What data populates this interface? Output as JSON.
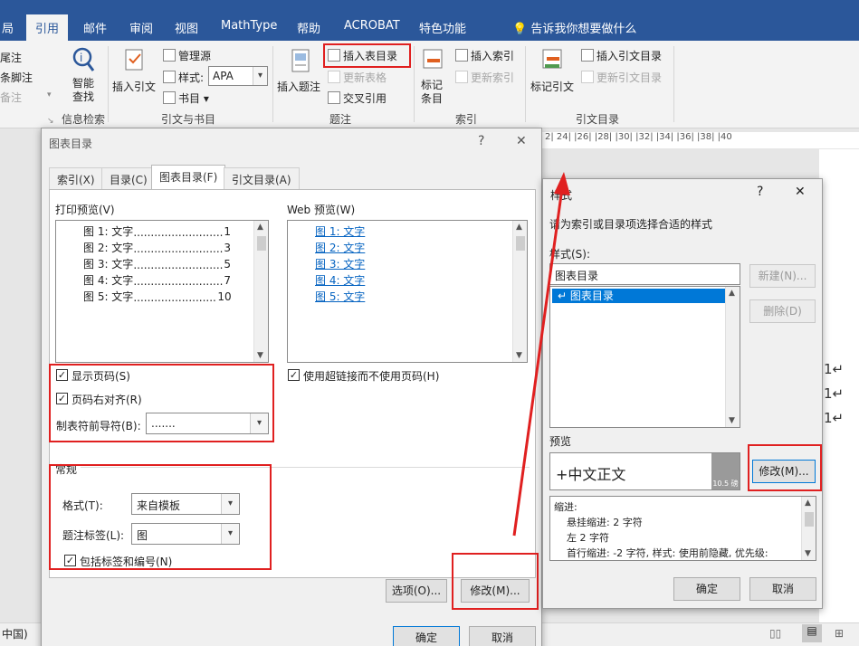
{
  "ribbon": {
    "tabs": [
      "局",
      "引用",
      "邮件",
      "审阅",
      "视图",
      "MathType",
      "帮助",
      "ACROBAT",
      "特色功能"
    ],
    "active_tab": "引用",
    "tell_me": "告诉我你想要做什么",
    "left_items": [
      "尾注",
      "条脚注",
      "备注"
    ],
    "smart_lookup": "智能查找",
    "insert_citation": "插入引文",
    "manage_sources": "管理源",
    "style_label": "样式:",
    "style_value": "APA",
    "bibliography": "书目",
    "insert_caption": "插入题注",
    "insert_table_of_figures": "插入表目录",
    "update_table": "更新表格",
    "cross_reference": "交叉引用",
    "mark_entry": "标记条目",
    "insert_index": "插入索引",
    "update_index": "更新索引",
    "mark_citation": "标记引文",
    "insert_table_of_authorities": "插入引文目录",
    "update_table_of_authorities": "更新引文目录",
    "group_research": "信息检索",
    "group_citations": "引文与书目",
    "group_captions": "题注",
    "group_index": "索引",
    "group_authorities": "引文目录"
  },
  "document": {
    "ruler_text": "2| 24|  |26|  |28|  |30|  |32|  |34|  |36|  |38|  |40",
    "page_numbers": [
      "1↵",
      "1↵",
      "1↵"
    ],
    "status_language": "中国)"
  },
  "tof_dialog": {
    "title": "图表目录",
    "help": "?",
    "close": "✕",
    "tabs": [
      "索引(X)",
      "目录(C)",
      "图表目录(F)",
      "引文目录(A)"
    ],
    "print_preview_label": "打印预览(V)",
    "web_preview_label": "Web 预览(W)",
    "print_entries": [
      {
        "text": "图 1: 文字",
        "page": "1"
      },
      {
        "text": "图 2: 文字",
        "page": "3"
      },
      {
        "text": "图 3: 文字",
        "page": "5"
      },
      {
        "text": "图 4: 文字",
        "page": "7"
      },
      {
        "text": "图 5: 文字",
        "page": "10"
      }
    ],
    "web_entries": [
      "图 1: 文字",
      "图 2: 文字",
      "图 3: 文字",
      "图 4: 文字",
      "图 5: 文字"
    ],
    "show_page_numbers": "显示页码(S)",
    "right_align": "页码右对齐(R)",
    "tab_leader_label": "制表符前导符(B):",
    "tab_leader_value": ".......",
    "use_hyperlinks": "使用超链接而不使用页码(H)",
    "general_label": "常规",
    "formats_label": "格式(T):",
    "formats_value": "来自模板",
    "caption_label": "题注标签(L):",
    "caption_value": "图",
    "include_label": "包括标签和编号(N)",
    "options_btn": "选项(O)...",
    "modify_btn": "修改(M)...",
    "ok_btn": "确定",
    "cancel_btn": "取消"
  },
  "style_dialog": {
    "title": "样式",
    "help": "?",
    "close": "✕",
    "instruction": "请为索引或目录项选择合适的样式",
    "styles_label": "样式(S):",
    "style_input": "图表目录",
    "style_list": [
      "↵ 图表目录"
    ],
    "new_btn": "新建(N)...",
    "delete_btn": "删除(D)",
    "preview_label": "预览",
    "preview_text": "+中文正文",
    "preview_size": "10.5 磅",
    "modify_btn": "修改(M)...",
    "desc_lines": [
      "缩进:",
      "悬挂缩进: 2 字符",
      "左  2 字符",
      "首行缩进: -2 字符, 样式: 使用前隐藏, 优先级:"
    ],
    "ok_btn": "确定",
    "cancel_btn": "取消"
  },
  "colors": {
    "ribbon_blue": "#2b579a",
    "highlight_red": "#e02020",
    "selection_blue": "#0078d7",
    "link_blue": "#0563c1"
  }
}
